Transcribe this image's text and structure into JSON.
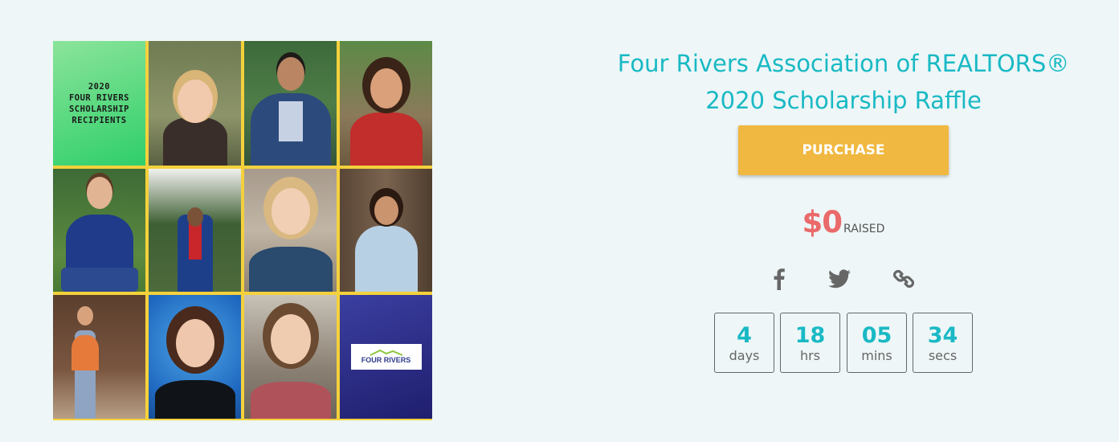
{
  "collage": {
    "title_text": "2020\nFOUR RIVERS\nSCHOLARSHIP\nRECIPIENTS",
    "logo_text": "FOUR RIVERS"
  },
  "campaign": {
    "title": "Four Rivers Association of REALTORS®\n2020 Scholarship Raffle",
    "purchase_label": "PURCHASE",
    "amount_raised": "$0",
    "raised_label": "RAISED"
  },
  "share": {
    "facebook_icon": "facebook-icon",
    "twitter_icon": "twitter-icon",
    "link_icon": "link-icon"
  },
  "countdown": {
    "days": "4",
    "days_label": "days",
    "hrs": "18",
    "hrs_label": "hrs",
    "mins": "05",
    "mins_label": "mins",
    "secs": "34",
    "secs_label": "secs"
  },
  "colors": {
    "accent": "#19b9c4",
    "button": "#f0b840",
    "raised": "#ea6a6a",
    "background": "#eef6f7"
  }
}
